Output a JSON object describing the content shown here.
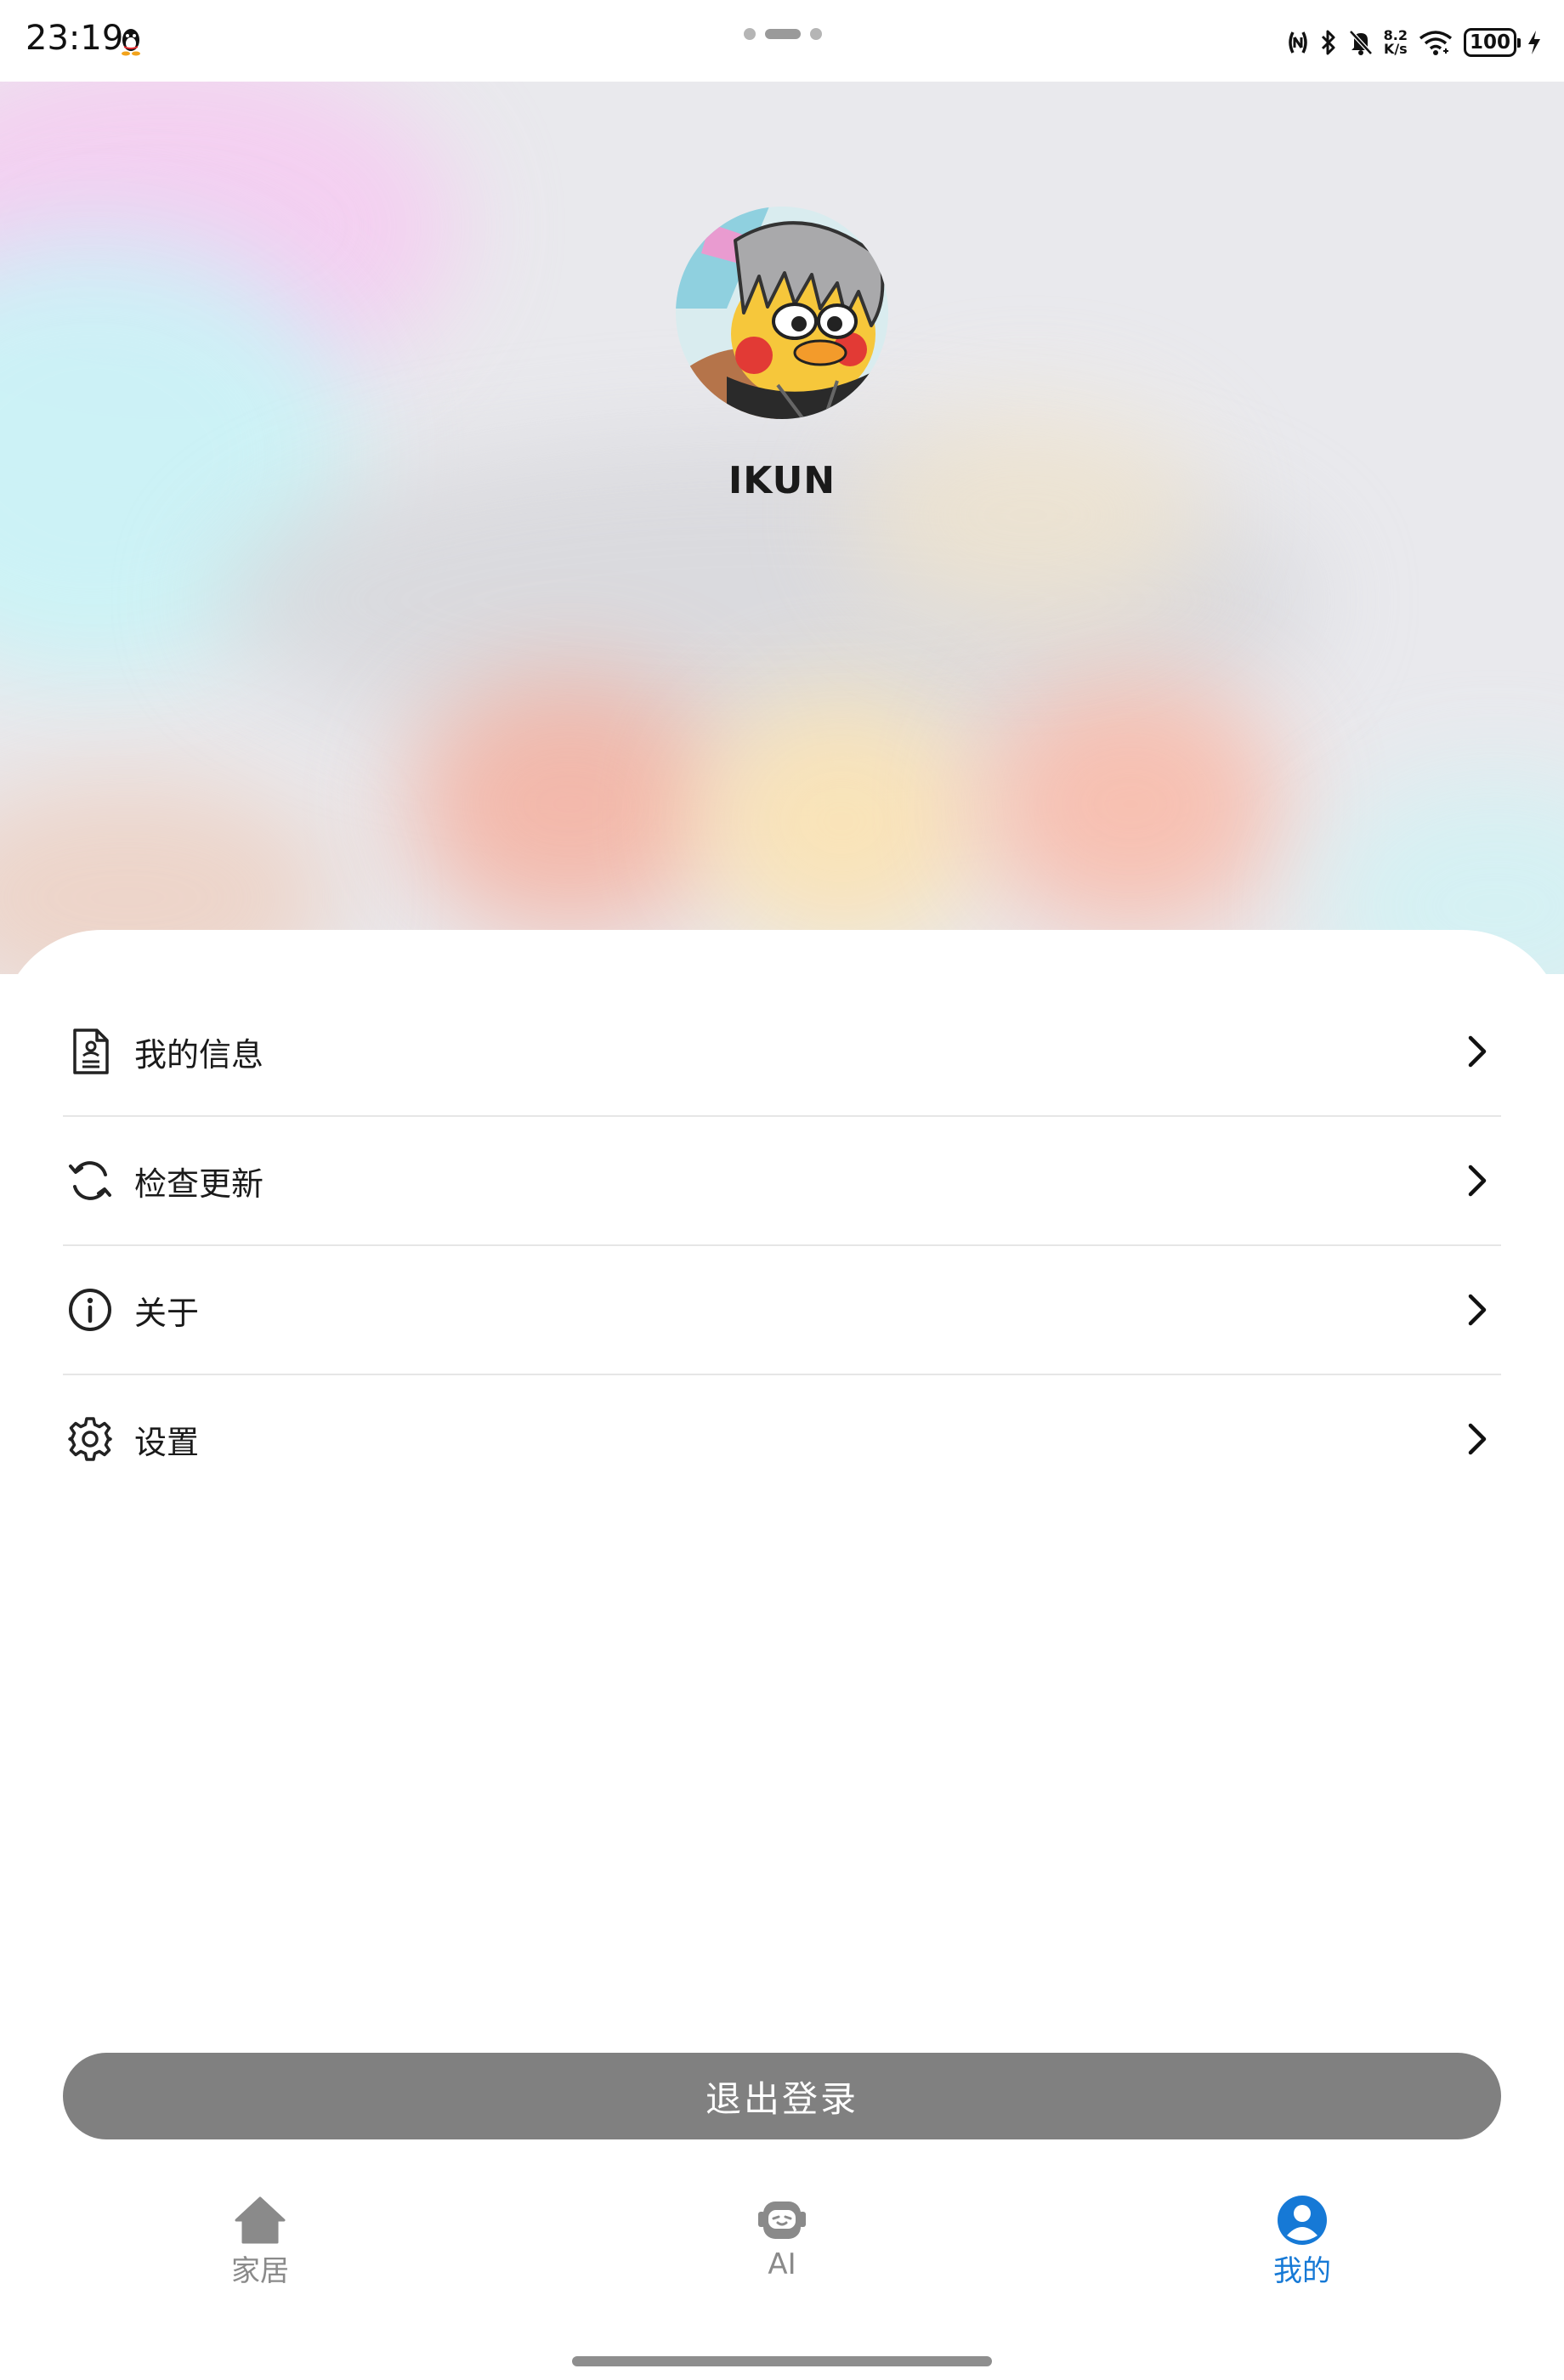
{
  "status_bar": {
    "time": "23:19",
    "net_speed_value": "8.2",
    "net_speed_unit": "K/s",
    "battery": "100",
    "icons": [
      "qq-icon",
      "nfc-icon",
      "bluetooth-icon",
      "mute-bell-icon",
      "wifi-icon",
      "charging-icon"
    ]
  },
  "profile": {
    "username": "IKUN",
    "avatar": "cartoon-duck-avatar"
  },
  "menu": {
    "items": [
      {
        "label": "我的信息",
        "icon": "document-icon"
      },
      {
        "label": "检查更新",
        "icon": "refresh-icon"
      },
      {
        "label": "关于",
        "icon": "info-icon"
      },
      {
        "label": "设置",
        "icon": "settings-gear-icon"
      }
    ]
  },
  "logout": {
    "label": "退出登录"
  },
  "bottom_nav": {
    "items": [
      {
        "label": "家居",
        "icon": "home-icon",
        "active": false
      },
      {
        "label": "AI",
        "icon": "robot-icon",
        "active": false
      },
      {
        "label": "我的",
        "icon": "user-icon",
        "active": true
      }
    ]
  },
  "colors": {
    "accent": "#1679d6",
    "logout_bg": "#808080",
    "inactive_nav": "#8a8a8a"
  }
}
